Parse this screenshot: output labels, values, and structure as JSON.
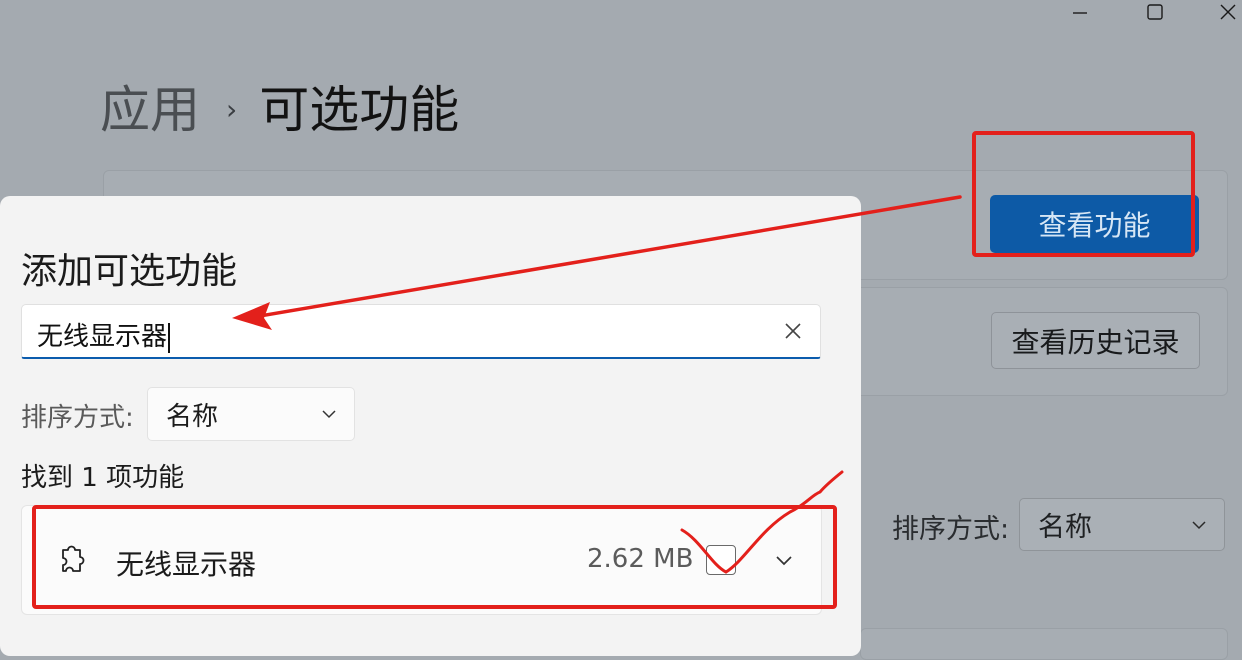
{
  "window": {
    "minimize_icon": "minimize-icon",
    "maximize_icon": "maximize-icon",
    "close_icon": "close-icon"
  },
  "breadcrumb": {
    "parent": "应用",
    "separator": "›",
    "current": "可选功能"
  },
  "background": {
    "view_features_button": "查看功能",
    "view_history_button": "查看历史记录",
    "sort_label": "排序方式:",
    "sort_value": "名称"
  },
  "dialog": {
    "title": "添加可选功能",
    "search": {
      "value": "无线显示器",
      "clear_icon": "close-icon"
    },
    "sort_label": "排序方式:",
    "sort_value": "名称",
    "found_text": "找到 1 项功能",
    "items": [
      {
        "name": "无线显示器",
        "size": "2.62 MB",
        "icon": "puzzle-icon",
        "checked": false
      }
    ]
  },
  "colors": {
    "accent": "#0d5aa6",
    "annotation_red": "#e3201b",
    "overlay": "#a4aab0"
  }
}
